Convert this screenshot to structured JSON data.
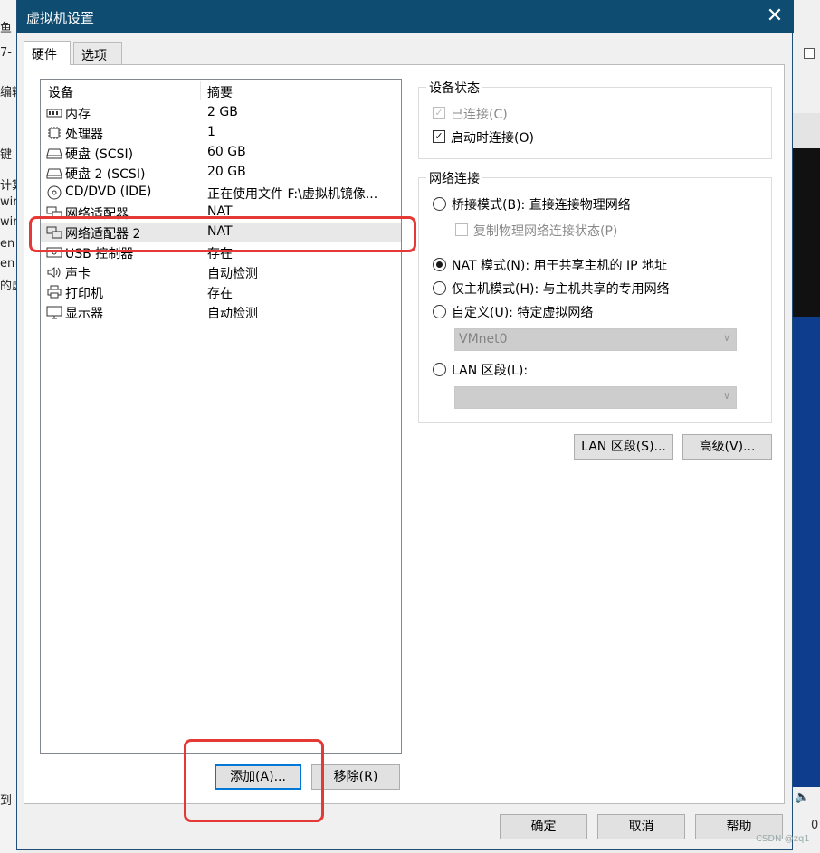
{
  "background_app": {
    "left_fragments": [
      "鱼",
      "7-",
      "编辑",
      "键",
      "计算",
      "win",
      "win",
      "en",
      "en",
      "的虚",
      "到"
    ],
    "tray_text": "0"
  },
  "dialog": {
    "title": "虚拟机设置",
    "close_glyph": "✕",
    "tabs": [
      {
        "label": "硬件",
        "active": true
      },
      {
        "label": "选项",
        "active": false
      }
    ]
  },
  "device_list": {
    "header": {
      "device": "设备",
      "summary": "摘要"
    },
    "items": [
      {
        "name": "内存",
        "summary": "2 GB",
        "icon": "memory-icon"
      },
      {
        "name": "处理器",
        "summary": "1",
        "icon": "cpu-icon"
      },
      {
        "name": "硬盘 (SCSI)",
        "summary": "60 GB",
        "icon": "harddisk-icon"
      },
      {
        "name": "硬盘 2 (SCSI)",
        "summary": "20 GB",
        "icon": "harddisk-icon"
      },
      {
        "name": "CD/DVD (IDE)",
        "summary": "正在使用文件 F:\\虚拟机镜像...",
        "icon": "cd-icon"
      },
      {
        "name": "网络适配器",
        "summary": "NAT",
        "icon": "network-icon"
      },
      {
        "name": "网络适配器 2",
        "summary": "NAT",
        "icon": "network-icon",
        "selected": true
      },
      {
        "name": "USB 控制器",
        "summary": "存在",
        "icon": "usb-icon"
      },
      {
        "name": "声卡",
        "summary": "自动检测",
        "icon": "speaker-icon"
      },
      {
        "name": "打印机",
        "summary": "存在",
        "icon": "printer-icon"
      },
      {
        "name": "显示器",
        "summary": "自动检测",
        "icon": "monitor-icon"
      }
    ],
    "add_button": "添加(A)...",
    "remove_button": "移除(R)"
  },
  "device_status": {
    "legend": "设备状态",
    "connected": {
      "label": "已连接(C)",
      "checked": true,
      "disabled": true
    },
    "connect_at_power_on": {
      "label": "启动时连接(O)",
      "checked": true
    }
  },
  "network_connection": {
    "legend": "网络连接",
    "options": {
      "bridged": "桥接模式(B): 直接连接物理网络",
      "replicate": "复制物理网络连接状态(P)",
      "nat": "NAT 模式(N): 用于共享主机的 IP 地址",
      "host_only": "仅主机模式(H): 与主机共享的专用网络",
      "custom": "自定义(U): 特定虚拟网络",
      "lan_segment": "LAN 区段(L):"
    },
    "selected": "nat",
    "custom_combo_value": "VMnet0",
    "lan_combo_value": ""
  },
  "side_buttons": {
    "lan_segments": "LAN 区段(S)...",
    "advanced": "高级(V)..."
  },
  "footer": {
    "ok": "确定",
    "cancel": "取消",
    "help": "帮助"
  },
  "watermark": "CSDN @zq1",
  "colors": {
    "titlebar": "#0f4c72",
    "annotation": "#e53935",
    "focus_border": "#0078d7",
    "background_blue": "#0d3d8c"
  }
}
